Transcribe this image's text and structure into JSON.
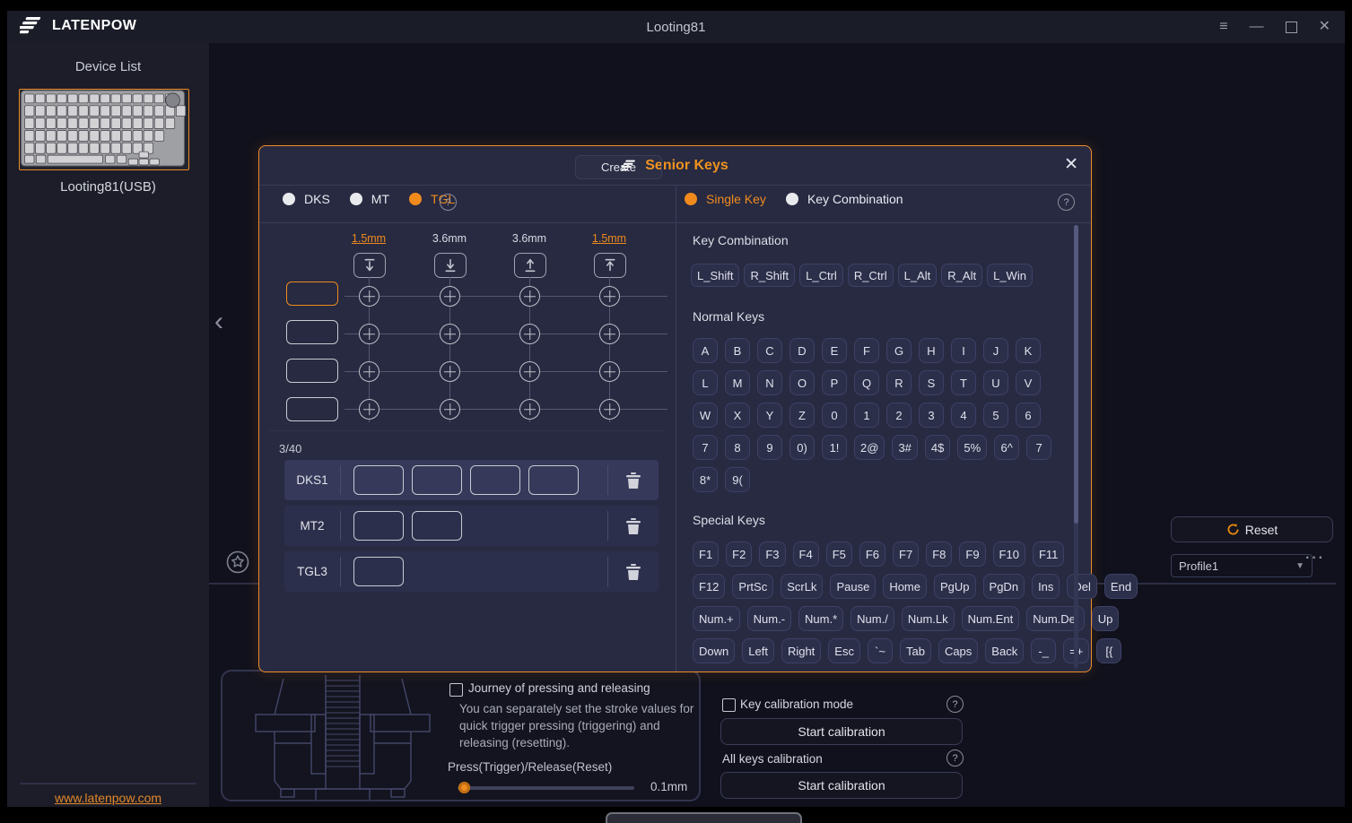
{
  "colors": {
    "accent": "#f08a1d",
    "modal_border": "#ef8c2a",
    "link": "#e2882a"
  },
  "icons": {
    "menu": "≡",
    "minimize": "—",
    "close": "✕",
    "help": "?",
    "chevron_left": "‹",
    "dropdown": "▼",
    "more": "···",
    "star": "star-badge",
    "trash": "trash-can",
    "reset": "refresh-arrow"
  },
  "window": {
    "brand": "LATENPOW",
    "title": "Looting81"
  },
  "sidebar": {
    "title": "Device List",
    "device": "Looting81(USB)",
    "link": "www.latenpow.com"
  },
  "main": {
    "reset": "Reset",
    "profile": "Profile1",
    "panel": {
      "checkbox_label": "Journey of pressing and releasing",
      "desc": "You can separately set the stroke values for quick trigger pressing (triggering) and releasing (resetting).",
      "slider_label": "Press(Trigger)/Release(Reset)",
      "slider_value": "0.1mm"
    },
    "calibration": {
      "key_mode": "Key calibration mode",
      "start_key": "Start calibration",
      "all_keys": "All keys calibration",
      "start_all": "Start calibration"
    }
  },
  "modal": {
    "title": "Senior Keys",
    "modes": [
      {
        "label": "DKS",
        "on": false
      },
      {
        "label": "MT",
        "on": false
      },
      {
        "label": "TGL",
        "on": true
      }
    ],
    "create": "Create",
    "key_modes": [
      {
        "label": "Single Key",
        "on": true
      },
      {
        "label": "Key Combination",
        "on": false
      }
    ],
    "left": {
      "columns": [
        {
          "label": "1.5mm",
          "accent": true
        },
        {
          "label": "3.6mm",
          "accent": false
        },
        {
          "label": "3.6mm",
          "accent": false
        },
        {
          "label": "1.5mm",
          "accent": true
        }
      ],
      "counter": "3/40",
      "groups": [
        {
          "name": "DKS1",
          "slots": 4
        },
        {
          "name": "MT2",
          "slots": 2
        },
        {
          "name": "TGL3",
          "slots": 1
        }
      ]
    },
    "right": {
      "combo_title": "Key Combination",
      "combo_keys": [
        "L_Shift",
        "R_Shift",
        "L_Ctrl",
        "R_Ctrl",
        "L_Alt",
        "R_Alt",
        "L_Win"
      ],
      "normal_title": "Normal Keys",
      "normal_rows": [
        [
          "A",
          "B",
          "C",
          "D",
          "E",
          "F",
          "G",
          "H",
          "I",
          "J",
          "K"
        ],
        [
          "L",
          "M",
          "N",
          "O",
          "P",
          "Q",
          "R",
          "S",
          "T",
          "U",
          "V"
        ],
        [
          "W",
          "X",
          "Y",
          "Z",
          "0",
          "1",
          "2",
          "3",
          "4",
          "5",
          "6"
        ],
        [
          "7",
          "8",
          "9",
          "0)",
          "1!",
          "2@",
          "3#",
          "4$",
          "5%",
          "6^",
          "7"
        ],
        [
          "8*",
          "9("
        ]
      ],
      "special_title": "Special Keys",
      "special_rows": [
        [
          "F1",
          "F2",
          "F3",
          "F4",
          "F5",
          "F6",
          "F7",
          "F8",
          "F9",
          "F10",
          "F11"
        ],
        [
          "F12",
          "PrtSc",
          "ScrLk",
          "Pause",
          "Home",
          "PgUp",
          "PgDn",
          "Ins",
          "Del",
          "End"
        ],
        [
          "Num.+",
          "Num.-",
          "Num.*",
          "Num./",
          "Num.Lk",
          "Num.Ent",
          "Num.Del",
          "Up"
        ],
        [
          "Down",
          "Left",
          "Right",
          "Esc",
          "`~",
          "Tab",
          "Caps",
          "Back",
          "-_",
          "=+",
          "[{"
        ]
      ]
    }
  }
}
